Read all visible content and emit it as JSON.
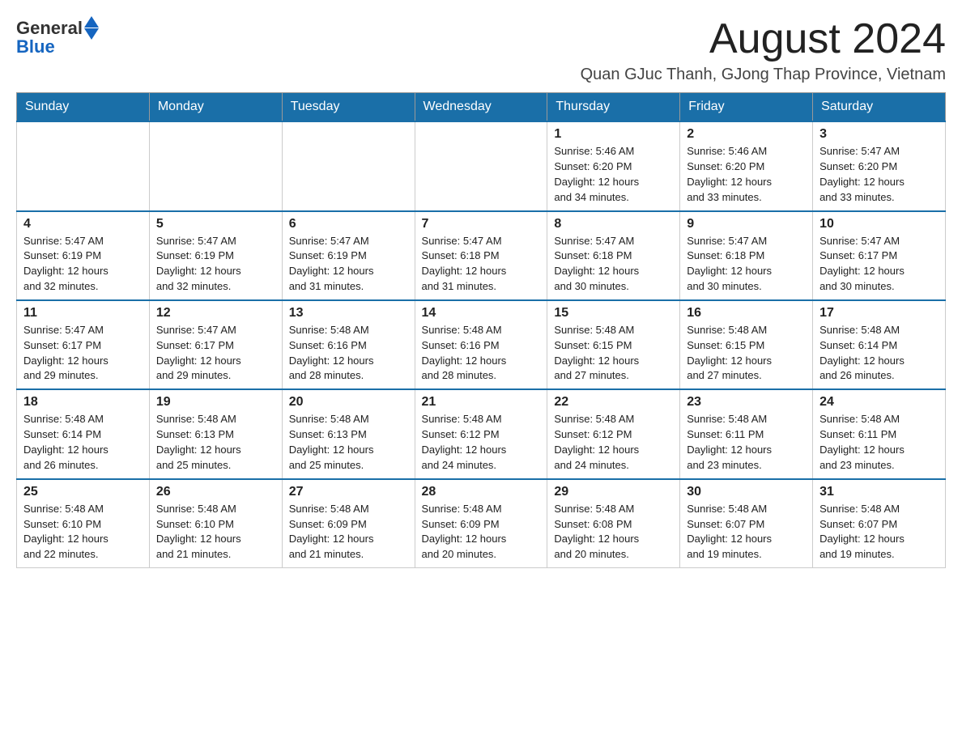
{
  "header": {
    "logo_general": "General",
    "logo_blue": "Blue",
    "month_title": "August 2024",
    "location": "Quan GJuc Thanh, GJong Thap Province, Vietnam"
  },
  "weekdays": [
    "Sunday",
    "Monday",
    "Tuesday",
    "Wednesday",
    "Thursday",
    "Friday",
    "Saturday"
  ],
  "weeks": [
    [
      {
        "day": "",
        "info": ""
      },
      {
        "day": "",
        "info": ""
      },
      {
        "day": "",
        "info": ""
      },
      {
        "day": "",
        "info": ""
      },
      {
        "day": "1",
        "info": "Sunrise: 5:46 AM\nSunset: 6:20 PM\nDaylight: 12 hours\nand 34 minutes."
      },
      {
        "day": "2",
        "info": "Sunrise: 5:46 AM\nSunset: 6:20 PM\nDaylight: 12 hours\nand 33 minutes."
      },
      {
        "day": "3",
        "info": "Sunrise: 5:47 AM\nSunset: 6:20 PM\nDaylight: 12 hours\nand 33 minutes."
      }
    ],
    [
      {
        "day": "4",
        "info": "Sunrise: 5:47 AM\nSunset: 6:19 PM\nDaylight: 12 hours\nand 32 minutes."
      },
      {
        "day": "5",
        "info": "Sunrise: 5:47 AM\nSunset: 6:19 PM\nDaylight: 12 hours\nand 32 minutes."
      },
      {
        "day": "6",
        "info": "Sunrise: 5:47 AM\nSunset: 6:19 PM\nDaylight: 12 hours\nand 31 minutes."
      },
      {
        "day": "7",
        "info": "Sunrise: 5:47 AM\nSunset: 6:18 PM\nDaylight: 12 hours\nand 31 minutes."
      },
      {
        "day": "8",
        "info": "Sunrise: 5:47 AM\nSunset: 6:18 PM\nDaylight: 12 hours\nand 30 minutes."
      },
      {
        "day": "9",
        "info": "Sunrise: 5:47 AM\nSunset: 6:18 PM\nDaylight: 12 hours\nand 30 minutes."
      },
      {
        "day": "10",
        "info": "Sunrise: 5:47 AM\nSunset: 6:17 PM\nDaylight: 12 hours\nand 30 minutes."
      }
    ],
    [
      {
        "day": "11",
        "info": "Sunrise: 5:47 AM\nSunset: 6:17 PM\nDaylight: 12 hours\nand 29 minutes."
      },
      {
        "day": "12",
        "info": "Sunrise: 5:47 AM\nSunset: 6:17 PM\nDaylight: 12 hours\nand 29 minutes."
      },
      {
        "day": "13",
        "info": "Sunrise: 5:48 AM\nSunset: 6:16 PM\nDaylight: 12 hours\nand 28 minutes."
      },
      {
        "day": "14",
        "info": "Sunrise: 5:48 AM\nSunset: 6:16 PM\nDaylight: 12 hours\nand 28 minutes."
      },
      {
        "day": "15",
        "info": "Sunrise: 5:48 AM\nSunset: 6:15 PM\nDaylight: 12 hours\nand 27 minutes."
      },
      {
        "day": "16",
        "info": "Sunrise: 5:48 AM\nSunset: 6:15 PM\nDaylight: 12 hours\nand 27 minutes."
      },
      {
        "day": "17",
        "info": "Sunrise: 5:48 AM\nSunset: 6:14 PM\nDaylight: 12 hours\nand 26 minutes."
      }
    ],
    [
      {
        "day": "18",
        "info": "Sunrise: 5:48 AM\nSunset: 6:14 PM\nDaylight: 12 hours\nand 26 minutes."
      },
      {
        "day": "19",
        "info": "Sunrise: 5:48 AM\nSunset: 6:13 PM\nDaylight: 12 hours\nand 25 minutes."
      },
      {
        "day": "20",
        "info": "Sunrise: 5:48 AM\nSunset: 6:13 PM\nDaylight: 12 hours\nand 25 minutes."
      },
      {
        "day": "21",
        "info": "Sunrise: 5:48 AM\nSunset: 6:12 PM\nDaylight: 12 hours\nand 24 minutes."
      },
      {
        "day": "22",
        "info": "Sunrise: 5:48 AM\nSunset: 6:12 PM\nDaylight: 12 hours\nand 24 minutes."
      },
      {
        "day": "23",
        "info": "Sunrise: 5:48 AM\nSunset: 6:11 PM\nDaylight: 12 hours\nand 23 minutes."
      },
      {
        "day": "24",
        "info": "Sunrise: 5:48 AM\nSunset: 6:11 PM\nDaylight: 12 hours\nand 23 minutes."
      }
    ],
    [
      {
        "day": "25",
        "info": "Sunrise: 5:48 AM\nSunset: 6:10 PM\nDaylight: 12 hours\nand 22 minutes."
      },
      {
        "day": "26",
        "info": "Sunrise: 5:48 AM\nSunset: 6:10 PM\nDaylight: 12 hours\nand 21 minutes."
      },
      {
        "day": "27",
        "info": "Sunrise: 5:48 AM\nSunset: 6:09 PM\nDaylight: 12 hours\nand 21 minutes."
      },
      {
        "day": "28",
        "info": "Sunrise: 5:48 AM\nSunset: 6:09 PM\nDaylight: 12 hours\nand 20 minutes."
      },
      {
        "day": "29",
        "info": "Sunrise: 5:48 AM\nSunset: 6:08 PM\nDaylight: 12 hours\nand 20 minutes."
      },
      {
        "day": "30",
        "info": "Sunrise: 5:48 AM\nSunset: 6:07 PM\nDaylight: 12 hours\nand 19 minutes."
      },
      {
        "day": "31",
        "info": "Sunrise: 5:48 AM\nSunset: 6:07 PM\nDaylight: 12 hours\nand 19 minutes."
      }
    ]
  ]
}
